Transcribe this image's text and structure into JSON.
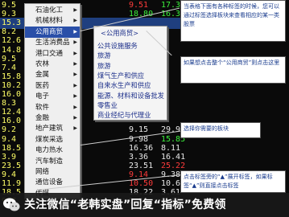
{
  "table": {
    "rows": [
      {
        "left": "9.5",
        "c2": "9.51",
        "c3": "17.30",
        "c2c": "red",
        "c3c": "green"
      },
      {
        "left": "9.3",
        "c2": "18.80",
        "c3": "16.3",
        "c2c": "green",
        "c3c": "green"
      },
      {
        "left": "15.3",
        "c2": "",
        "c3": "",
        "c2c": "white",
        "c3c": "white"
      },
      {
        "left": "8.2",
        "c2": "",
        "c3": "",
        "c2c": "white",
        "c3c": "white"
      },
      {
        "left": "12.6",
        "c2": "",
        "c3": "",
        "c2c": "white",
        "c3c": "white"
      },
      {
        "left": "14.8",
        "c2": "",
        "c3": "",
        "c2c": "white",
        "c3c": "white"
      },
      {
        "left": "9.5",
        "c2": "",
        "c3": "",
        "c2c": "white",
        "c3c": "white"
      },
      {
        "left": "7.4",
        "c2": "",
        "c3": "",
        "c2c": "white",
        "c3c": "white"
      },
      {
        "left": "15.8",
        "c2": "",
        "c3": "",
        "c2c": "white",
        "c3c": "white"
      },
      {
        "left": "10.2",
        "c2": "",
        "c3": "",
        "c2c": "white",
        "c3c": "white"
      },
      {
        "left": "16.0",
        "c2": "",
        "c3": "",
        "c2c": "white",
        "c3c": "white"
      },
      {
        "left": "8.3",
        "c2": "",
        "c3": "",
        "c2c": "white",
        "c3c": "white"
      },
      {
        "left": "12.4",
        "c2": "",
        "c3": "",
        "c2c": "white",
        "c3c": "white"
      },
      {
        "left": "16.0",
        "c2": "",
        "c3": "",
        "c2c": "white",
        "c3c": "white"
      },
      {
        "left": "9.2",
        "c2": "9.15",
        "c3": "29.99",
        "c2c": "white",
        "c3c": "white"
      },
      {
        "left": "9.4",
        "c2": "9.98",
        "c3": "15.85",
        "c2c": "white",
        "c3c": "green"
      },
      {
        "left": "18.5",
        "c2": "16.36",
        "c3": "8.11",
        "c2c": "white",
        "c3c": "white"
      },
      {
        "left": "3.9",
        "c2": "3.36",
        "c3": "16.41",
        "c2c": "white",
        "c3c": "white"
      },
      {
        "left": "23.5",
        "c2": "23.51",
        "c3": "25.22",
        "c2c": "white",
        "c3c": "red"
      },
      {
        "left": "9.4",
        "c2": "9.14",
        "c3": "9.38",
        "c2c": "red",
        "c3c": "white"
      },
      {
        "left": "11.9",
        "c2": "10.50",
        "c3": "10.63",
        "c2c": "red",
        "c3c": "white"
      },
      {
        "left": "18.5",
        "c2": "18.22",
        "c3": "3.61",
        "c2c": "white",
        "c3c": "white"
      },
      {
        "left": "9.7",
        "c2": "9.50",
        "c3": "9.66",
        "c2c": "white",
        "c3c": "white"
      }
    ]
  },
  "menu1": {
    "items": [
      {
        "label": "石油化工",
        "arrow": "▶",
        "active": false
      },
      {
        "label": "机械材料",
        "arrow": "▶",
        "active": false
      },
      {
        "label": "公用商贸",
        "arrow": "▶",
        "active": true
      },
      {
        "label": "生活消费品",
        "arrow": "▶",
        "active": false
      },
      {
        "label": "港口交通",
        "arrow": "▶",
        "active": false
      },
      {
        "label": "农林",
        "arrow": "▶",
        "active": false
      },
      {
        "label": "金属",
        "arrow": "▶",
        "active": false
      },
      {
        "label": "医药",
        "arrow": "▶",
        "active": false
      },
      {
        "label": "电子",
        "arrow": "▶",
        "active": false
      },
      {
        "label": "软件",
        "arrow": "▶",
        "active": false
      },
      {
        "label": "金融",
        "arrow": "▶",
        "active": false
      },
      {
        "label": "地产建筑",
        "arrow": "▶",
        "active": false
      },
      {
        "label": "煤炭采选",
        "arrow": "",
        "active": false
      },
      {
        "label": "电力热水",
        "arrow": "",
        "active": false
      },
      {
        "label": "汽车制造",
        "arrow": "",
        "active": false
      },
      {
        "label": "网络",
        "arrow": "",
        "active": false
      },
      {
        "label": "通信设备",
        "arrow": "",
        "active": false
      },
      {
        "label": "传媒",
        "arrow": "",
        "active": false
      }
    ]
  },
  "menu2": {
    "header": "<公用商贸>",
    "items": [
      "公共设施服务",
      "旅游",
      "旅游",
      "煤气生产和供应",
      "自来水生产和供应",
      "能源、材料和设备批发",
      "零售业",
      "商业经纪与代理业"
    ]
  },
  "notes": {
    "n1": "当表格下面有各种标签的时候，您可以通过标签选择板块来查看相应的某一类股票",
    "n2": "如果想点击整个“公用商贸”则点击这里",
    "n3": "选择你需要的板块",
    "n4": "点击标签旁的“▲”展开标签，如果标签“▲”则直接点击标签"
  },
  "caption": {
    "text": "关注微信“老韩实盘”回复“指标”免费领"
  },
  "colors": {
    "menu_active": "#2a4fa8",
    "menu2_text": "#1c2f8a",
    "note_text": "#1a3c8e"
  }
}
